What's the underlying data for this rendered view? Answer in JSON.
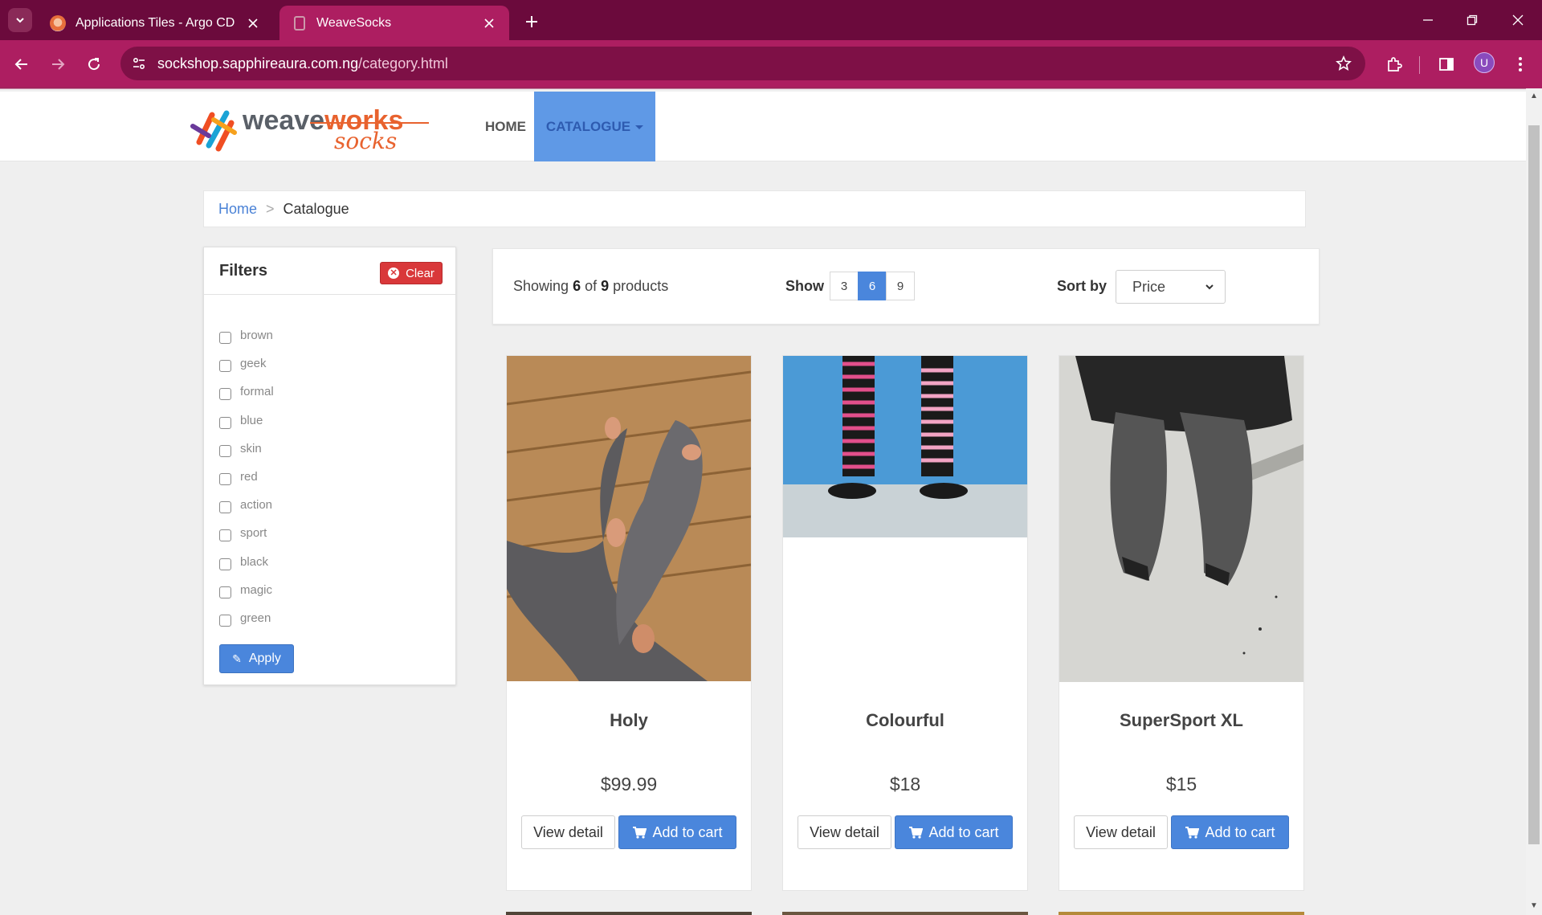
{
  "browser": {
    "tabs": [
      {
        "title": "Applications Tiles - Argo CD"
      },
      {
        "title": "WeaveSocks"
      }
    ],
    "url_host": "sockshop.sapphireaura.com.ng",
    "url_path": "/category.html",
    "profile_initial": "U",
    "accent": "#ad1e61"
  },
  "nav": {
    "logo_text": "weaveworks",
    "logo_sub": "socks",
    "home": "HOME",
    "catalogue": "CATALOGUE"
  },
  "breadcrumb": {
    "home": "Home",
    "sep": ">",
    "current": "Catalogue"
  },
  "filters": {
    "title": "Filters",
    "clear": "Clear",
    "apply": "Apply",
    "tags": [
      "brown",
      "geek",
      "formal",
      "blue",
      "skin",
      "red",
      "action",
      "sport",
      "black",
      "magic",
      "green"
    ]
  },
  "listing": {
    "showing_prefix": "Showing",
    "showing_count": "6",
    "showing_of": "of",
    "showing_total": "9",
    "showing_suffix": "products",
    "show_label": "Show",
    "page_sizes": [
      "3",
      "6",
      "9"
    ],
    "active_page_size": "6",
    "sort_label": "Sort by",
    "sort_value": "Price"
  },
  "products": [
    {
      "name": "Holy",
      "price": "$99.99",
      "view": "View detail",
      "cart": "Add to cart"
    },
    {
      "name": "Colourful",
      "price": "$18",
      "view": "View detail",
      "cart": "Add to cart"
    },
    {
      "name": "SuperSport XL",
      "price": "$15",
      "view": "View detail",
      "cart": "Add to cart"
    }
  ]
}
